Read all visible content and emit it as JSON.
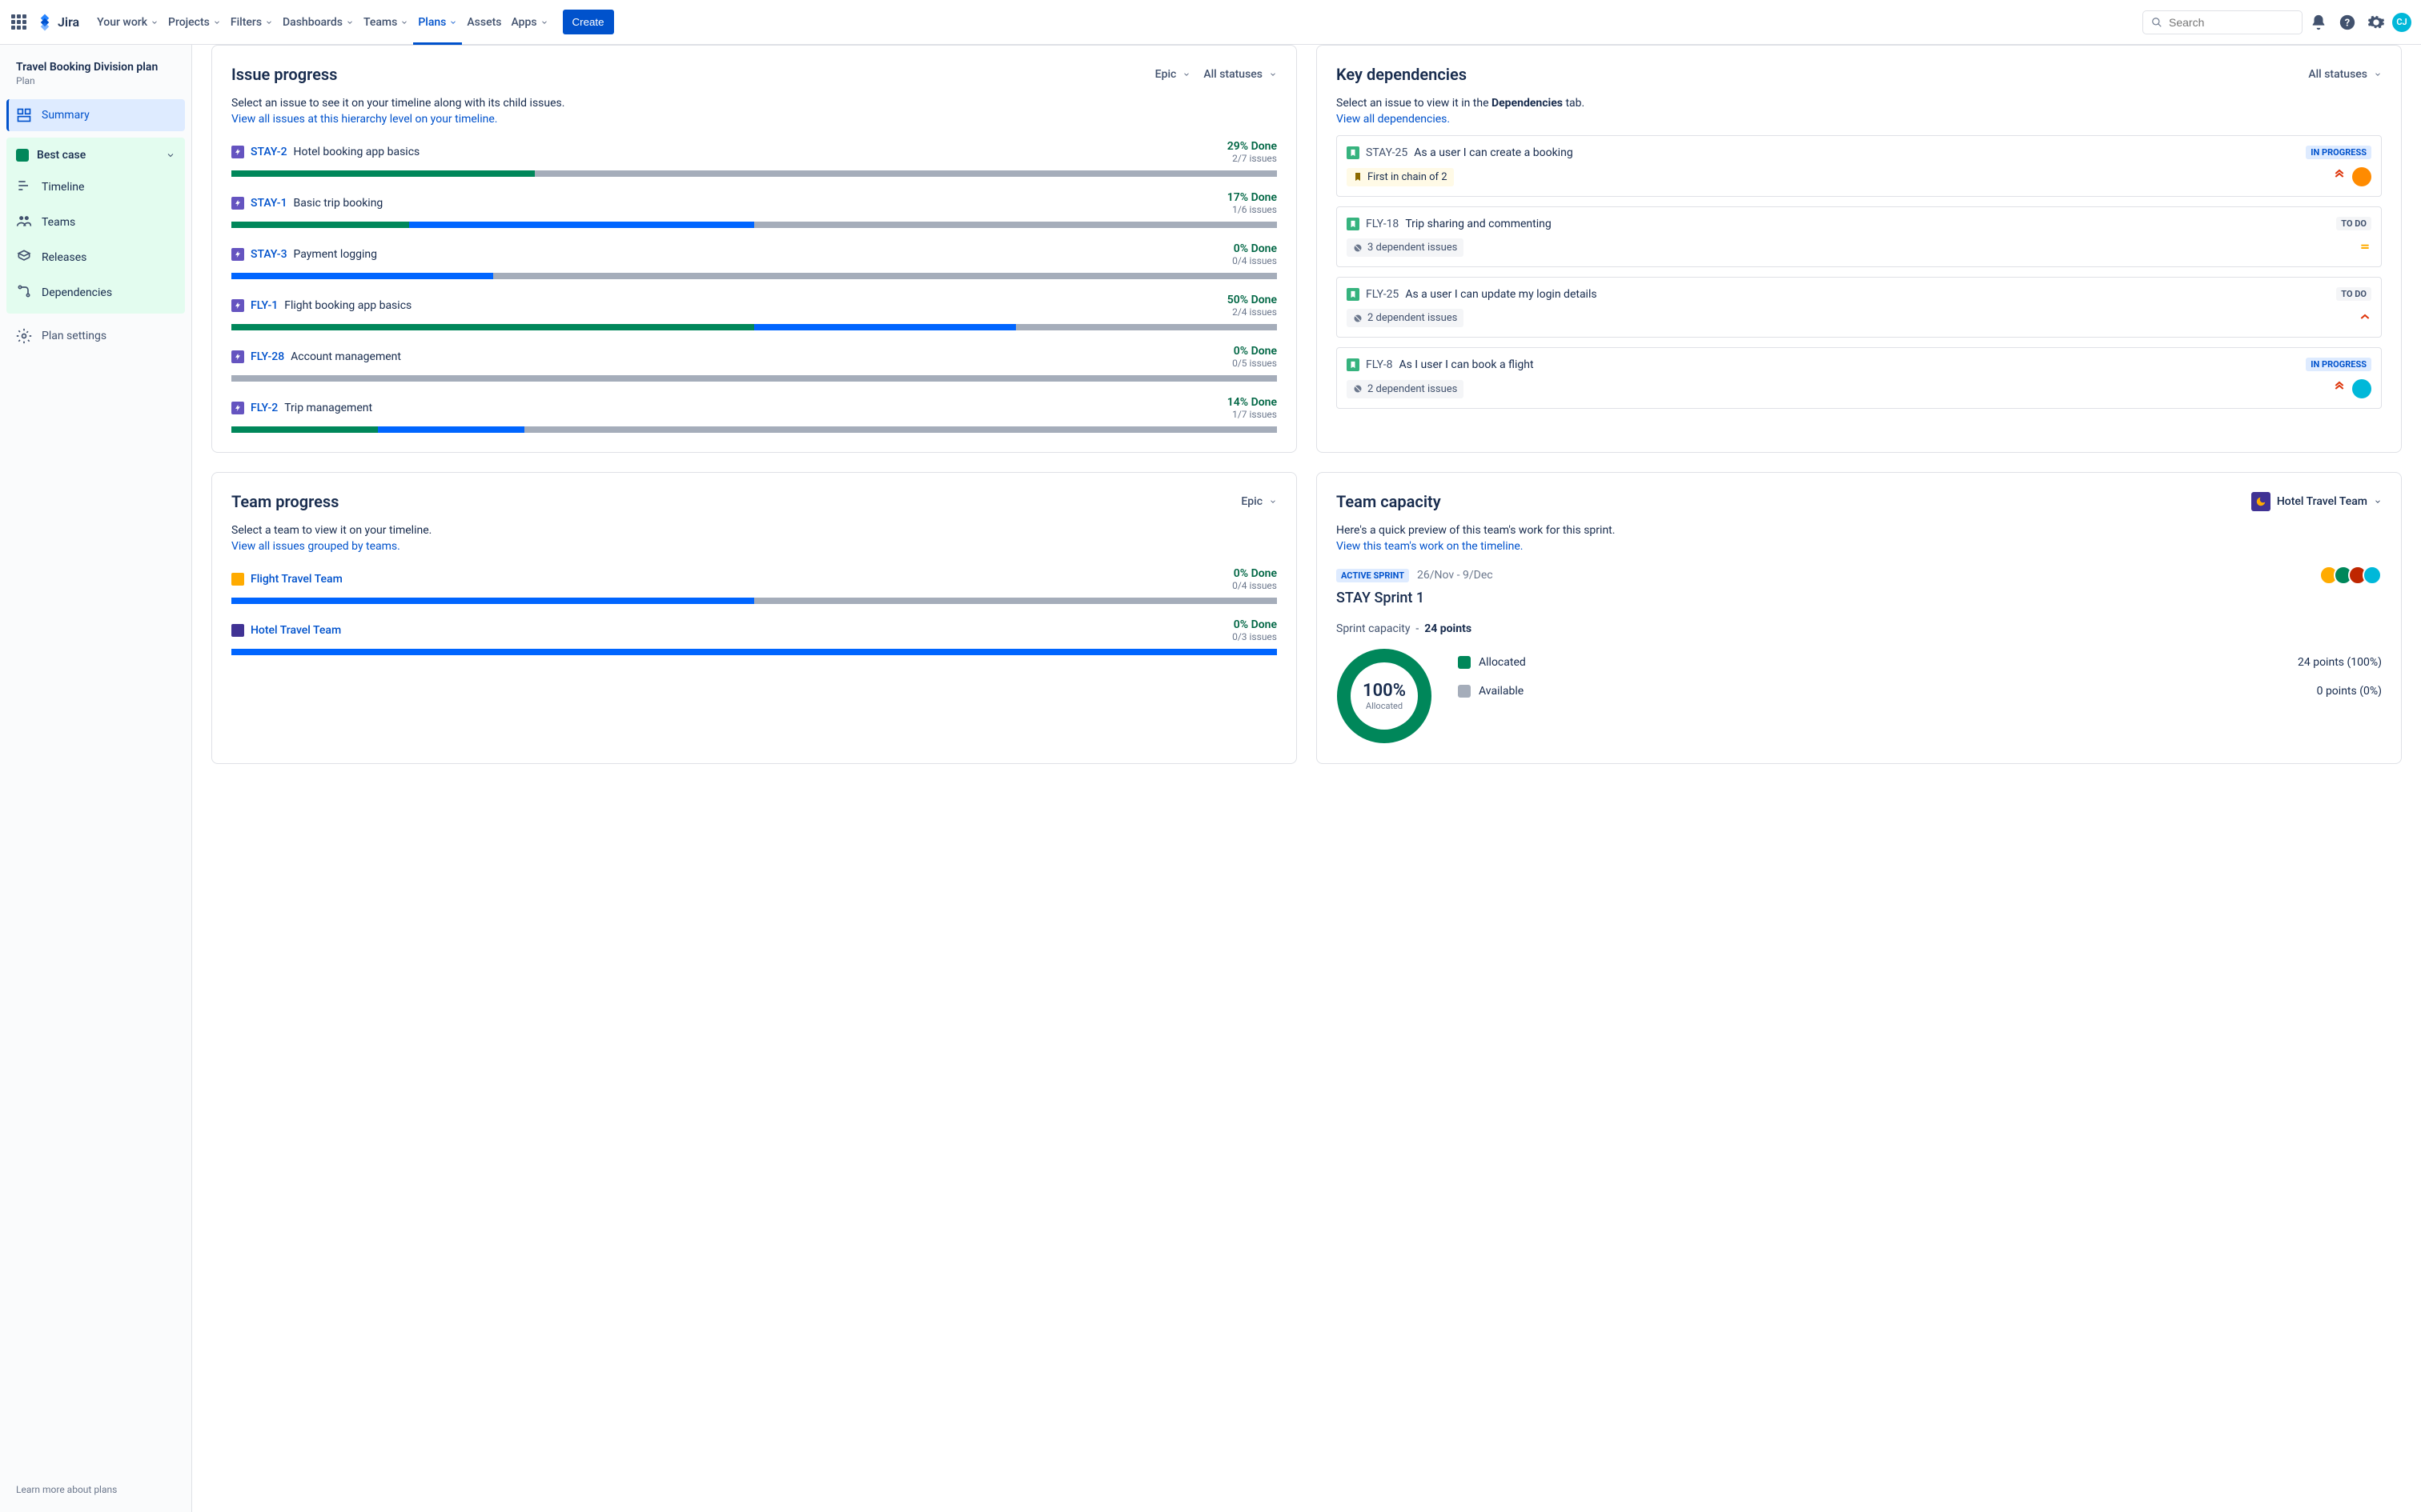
{
  "nav": {
    "product": "Jira",
    "items": [
      "Your work",
      "Projects",
      "Filters",
      "Dashboards",
      "Teams",
      "Plans",
      "Assets",
      "Apps"
    ],
    "active_index": 5,
    "create": "Create",
    "search_placeholder": "Search",
    "avatar_initials": "CJ"
  },
  "sidebar": {
    "plan_name": "Travel Booking Division plan",
    "plan_sub": "Plan",
    "summary": "Summary",
    "scenario": "Best case",
    "items": [
      "Timeline",
      "Teams",
      "Releases",
      "Dependencies"
    ],
    "settings": "Plan settings",
    "learn_more": "Learn more about plans"
  },
  "issue_progress": {
    "title": "Issue progress",
    "select_hierarchy": "Epic",
    "select_status": "All statuses",
    "desc": "Select an issue to see it on your timeline along with its child issues.",
    "link": "View all issues at this hierarchy level on your timeline.",
    "issues": [
      {
        "key": "STAY-2",
        "title": "Hotel booking app basics",
        "pct": "29% Done",
        "sub": "2/7 issues",
        "green": 29,
        "blue": 0
      },
      {
        "key": "STAY-1",
        "title": "Basic trip booking",
        "pct": "17% Done",
        "sub": "1/6 issues",
        "green": 17,
        "blue": 33
      },
      {
        "key": "STAY-3",
        "title": "Payment logging",
        "pct": "0% Done",
        "sub": "0/4 issues",
        "green": 0,
        "blue": 25
      },
      {
        "key": "FLY-1",
        "title": "Flight booking app basics",
        "pct": "50% Done",
        "sub": "2/4 issues",
        "green": 50,
        "blue": 25
      },
      {
        "key": "FLY-28",
        "title": "Account management",
        "pct": "0% Done",
        "sub": "0/5 issues",
        "green": 0,
        "blue": 0
      },
      {
        "key": "FLY-2",
        "title": "Trip management",
        "pct": "14% Done",
        "sub": "1/7 issues",
        "green": 14,
        "blue": 14
      }
    ]
  },
  "dependencies": {
    "title": "Key dependencies",
    "select_status": "All statuses",
    "desc_pre": "Select an issue to view it in the ",
    "desc_bold": "Dependencies",
    "desc_post": " tab.",
    "link": "View all dependencies.",
    "items": [
      {
        "key": "STAY-25",
        "title": "As a user I can create a booking",
        "status": "IN PROGRESS",
        "status_class": "lz-inprogress",
        "chain": "First in chain of 2",
        "chain_type": "chain",
        "priority": "highest",
        "assignee_color": "#FF8B00"
      },
      {
        "key": "FLY-18",
        "title": "Trip sharing and commenting",
        "status": "TO DO",
        "status_class": "lz-todo",
        "chain": "3 dependent issues",
        "chain_type": "count",
        "priority": "medium",
        "assignee_color": ""
      },
      {
        "key": "FLY-25",
        "title": "As a user I can update my login details",
        "status": "TO DO",
        "status_class": "lz-todo",
        "chain": "2 dependent issues",
        "chain_type": "count",
        "priority": "high",
        "assignee_color": ""
      },
      {
        "key": "FLY-8",
        "title": "As I user I can book a flight",
        "status": "IN PROGRESS",
        "status_class": "lz-inprogress",
        "chain": "2 dependent issues",
        "chain_type": "count",
        "priority": "highest",
        "assignee_color": "#00B8D9"
      }
    ]
  },
  "team_progress": {
    "title": "Team progress",
    "select_hierarchy": "Epic",
    "desc": "Select a team to view it on your timeline.",
    "link": "View all issues grouped by teams.",
    "teams": [
      {
        "name": "Flight Travel Team",
        "pct": "0% Done",
        "sub": "0/4 issues",
        "color": "#FFAB00",
        "blue": 50
      },
      {
        "name": "Hotel Travel Team",
        "pct": "0% Done",
        "sub": "0/3 issues",
        "color": "#403294",
        "blue": 100
      }
    ]
  },
  "capacity": {
    "title": "Team capacity",
    "team": "Hotel Travel Team",
    "desc": "Here's a quick preview of this team's work for this sprint.",
    "link": "View this team's work on the timeline.",
    "active_sprint": "ACTIVE SPRINT",
    "dates": "26/Nov - 9/Dec",
    "sprint_name": "STAY Sprint 1",
    "capacity_label": "Sprint capacity",
    "capacity_value": "24 points",
    "donut_pct": "100%",
    "donut_label": "Allocated",
    "avatars": [
      "#FFAB00",
      "#00875A",
      "#BF2600",
      "#00B8D9"
    ],
    "legend": [
      {
        "label": "Allocated",
        "color": "#00875A",
        "value": "24 points (100%)"
      },
      {
        "label": "Available",
        "color": "#A5ADBA",
        "value": "0 points (0%)"
      }
    ]
  }
}
